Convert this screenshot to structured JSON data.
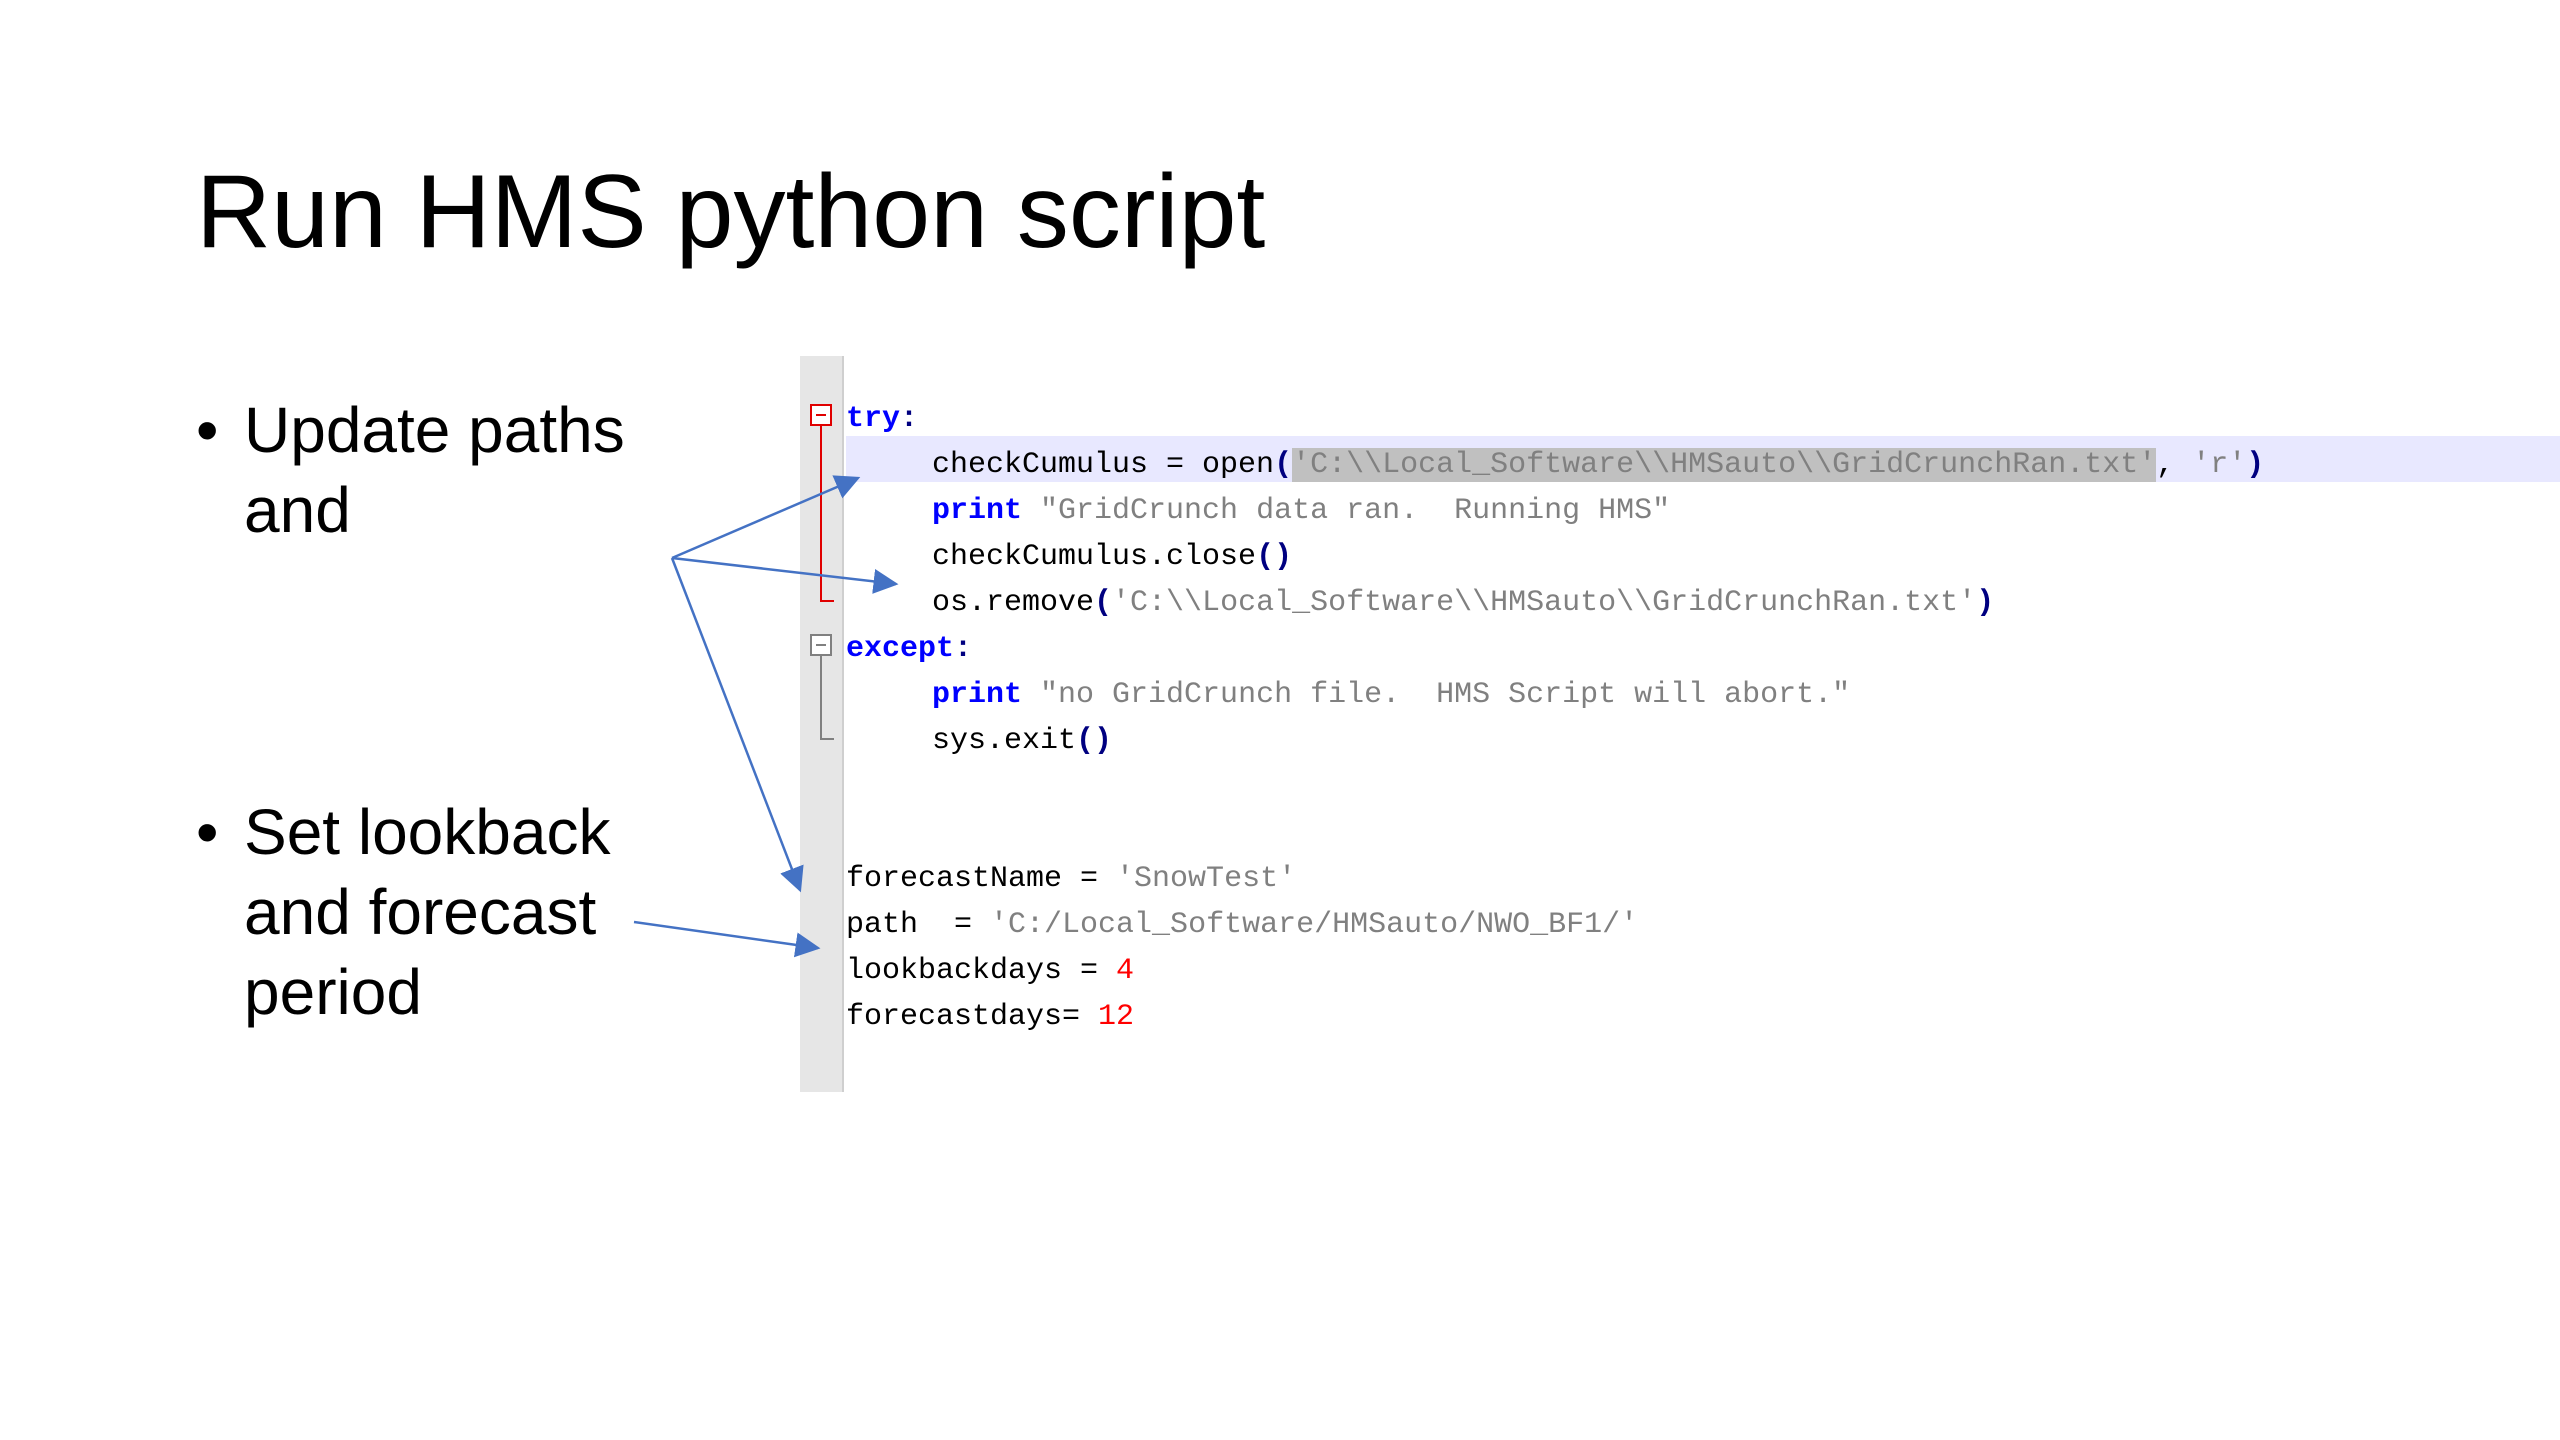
{
  "slide": {
    "title": "Run HMS python script",
    "bullets": [
      {
        "marker": "•",
        "text": "Update paths and"
      },
      {
        "marker": "•",
        "text": "Set lookback and forecast period"
      }
    ]
  },
  "code": {
    "lines": [
      {
        "type": "try",
        "tokens": [
          {
            "cls": "kw",
            "t": "try"
          },
          {
            "cls": "op",
            "t": ":"
          }
        ]
      },
      {
        "type": "plain",
        "tokens": [
          {
            "cls": "",
            "t": "checkCumulus = open"
          },
          {
            "cls": "op",
            "t": "("
          },
          {
            "cls": "str sel",
            "t": "'C:\\\\Local_Software\\\\HMSauto\\\\GridCrunchRan.txt'"
          },
          {
            "cls": "",
            "t": ", "
          },
          {
            "cls": "str",
            "t": "'r'"
          },
          {
            "cls": "op",
            "t": ")"
          }
        ]
      },
      {
        "type": "plain",
        "tokens": [
          {
            "cls": "kw",
            "t": "print"
          },
          {
            "cls": "",
            "t": " "
          },
          {
            "cls": "str",
            "t": "\"GridCrunch data ran.  Running HMS\""
          }
        ]
      },
      {
        "type": "plain",
        "tokens": [
          {
            "cls": "",
            "t": "checkCumulus.close"
          },
          {
            "cls": "op",
            "t": "()"
          }
        ]
      },
      {
        "type": "plain",
        "tokens": [
          {
            "cls": "",
            "t": "os.remove"
          },
          {
            "cls": "op",
            "t": "("
          },
          {
            "cls": "str",
            "t": "'C:\\\\Local_Software\\\\HMSauto\\\\GridCrunchRan.txt'"
          },
          {
            "cls": "op",
            "t": ")"
          }
        ]
      },
      {
        "type": "except",
        "tokens": [
          {
            "cls": "kw",
            "t": "except"
          },
          {
            "cls": "op",
            "t": ":"
          }
        ]
      },
      {
        "type": "plain",
        "tokens": [
          {
            "cls": "kw",
            "t": "print"
          },
          {
            "cls": "",
            "t": " "
          },
          {
            "cls": "str",
            "t": "\"no GridCrunch file.  HMS Script will abort.\""
          }
        ]
      },
      {
        "type": "plain",
        "tokens": [
          {
            "cls": "",
            "t": "sys.exit"
          },
          {
            "cls": "op",
            "t": "()"
          }
        ]
      },
      {
        "type": "blank",
        "tokens": []
      },
      {
        "type": "blank",
        "tokens": []
      },
      {
        "type": "assign",
        "tokens": [
          {
            "cls": "",
            "t": "forecastName = "
          },
          {
            "cls": "str",
            "t": "'SnowTest'"
          }
        ]
      },
      {
        "type": "assign",
        "tokens": [
          {
            "cls": "",
            "t": "path  = "
          },
          {
            "cls": "str",
            "t": "'C:/Local_Software/HMSauto/NWO_BF1/'"
          }
        ]
      },
      {
        "type": "assign",
        "tokens": [
          {
            "cls": "",
            "t": "lookbackdays = "
          },
          {
            "cls": "num",
            "t": "4"
          }
        ]
      },
      {
        "type": "assign",
        "tokens": [
          {
            "cls": "",
            "t": "forecastdays= "
          },
          {
            "cls": "num",
            "t": "12"
          }
        ]
      }
    ],
    "highlighted_line": 2,
    "colors": {
      "keyword": "#0000ff",
      "string": "#808080",
      "number": "#ff0000",
      "operator": "#000080",
      "selection": "#c0c0c0",
      "line_highlight": "#e8e8ff",
      "fold_active": "#e00000",
      "fold_inactive": "#808080",
      "gutter": "#e6e6e6",
      "arrow": "#4472c4"
    }
  }
}
